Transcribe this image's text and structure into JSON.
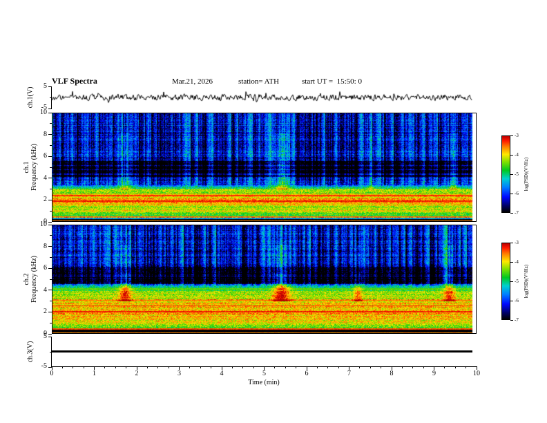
{
  "header": {
    "title": "VLF Spectra",
    "date": "Mar.21, 2026",
    "station": "station= ATH",
    "start_ut": "start UT =  15:50: 0"
  },
  "axes": {
    "time_label": "Time (min)",
    "x_range": [
      0,
      10
    ],
    "xtick_labels": [
      "0",
      "1",
      "2",
      "3",
      "4",
      "5",
      "6",
      "7",
      "8",
      "9",
      "10"
    ],
    "freq_tick_labels": [
      "10",
      "8",
      "6",
      "4",
      "2",
      "0"
    ],
    "volt_tick_top": "5",
    "volt_tick_bottom": "-5"
  },
  "panels": {
    "ch1_wave": {
      "label": "ch.1(V)"
    },
    "ch1_spec": {
      "label_ch": "ch.1",
      "label_axis": "Frequency (kHz)"
    },
    "ch2_spec": {
      "label_ch": "ch.2",
      "label_axis": "Frequency (kHz)"
    },
    "ch3_wave": {
      "label": "ch.3(V)"
    }
  },
  "colorbar": {
    "label": "log(PSD)(V²/Hz)",
    "tick_labels": [
      "-3",
      "-4",
      "-5",
      "-6",
      "-7"
    ],
    "value_top": -3,
    "value_bottom": -7,
    "stops": [
      {
        "pos": 0.0,
        "color": "#000000"
      },
      {
        "pos": 0.08,
        "color": "#000060"
      },
      {
        "pos": 0.2,
        "color": "#0008ff"
      },
      {
        "pos": 0.33,
        "color": "#0080ff"
      },
      {
        "pos": 0.44,
        "color": "#00d0d0"
      },
      {
        "pos": 0.55,
        "color": "#00c820"
      },
      {
        "pos": 0.66,
        "color": "#80e000"
      },
      {
        "pos": 0.76,
        "color": "#ffe800"
      },
      {
        "pos": 0.86,
        "color": "#ff8000"
      },
      {
        "pos": 0.94,
        "color": "#ff1800"
      },
      {
        "pos": 1.0,
        "color": "#b80000"
      }
    ]
  },
  "chart_data": [
    {
      "type": "line",
      "name": "ch1_waveform",
      "ylabel": "ch.1(V)",
      "ylim": [
        -5,
        5
      ],
      "xlim_min": [
        0,
        10
      ],
      "t_end": 9.9,
      "signal": {
        "mean": 0,
        "noise_amp": 1.2,
        "spike_prob": 0.05,
        "spike_amp": 3.2,
        "seed": 9
      }
    },
    {
      "type": "heatmap",
      "name": "ch1_spectrogram",
      "ylabel": "ch.1 Frequency (kHz)",
      "xlim_min": [
        0,
        10
      ],
      "ylim_khz": [
        0,
        10
      ],
      "zlabel": "log(PSD)(V²/Hz)",
      "zlim": [
        -7,
        -3
      ],
      "t_end": 9.9,
      "seed": 42,
      "stripe_density": 0.55,
      "stripe_fmin": 3.1,
      "stripe_max": 2.1,
      "bands": [
        {
          "f0": 0.0,
          "f1": 0.3,
          "level": -7.0
        },
        {
          "f0": 0.3,
          "f1": 0.42,
          "level": -5.6
        },
        {
          "f0": 0.42,
          "f1": 0.56,
          "level": -3.6
        },
        {
          "f0": 0.56,
          "f1": 0.85,
          "level": -4.6
        },
        {
          "f0": 0.85,
          "f1": 1.5,
          "level": -4.2
        },
        {
          "f0": 1.5,
          "f1": 2.65,
          "level": -3.8
        },
        {
          "f0": 2.65,
          "f1": 3.05,
          "level": -4.4
        },
        {
          "f0": 3.05,
          "f1": 4.15,
          "level": -5.0
        },
        {
          "f0": 4.15,
          "f1": 5.6,
          "level": -5.9
        },
        {
          "f0": 5.6,
          "f1": 10.01,
          "level": -5.05
        }
      ],
      "lines": [
        {
          "f": 0.1,
          "w": 0.06,
          "level": -3.6
        },
        {
          "f": 0.5,
          "w": 0.05,
          "level": -3.5
        },
        {
          "f": 1.92,
          "w": 0.05,
          "level": -3.2
        },
        {
          "f": 2.42,
          "w": 0.05,
          "level": -3.3
        },
        {
          "f": 4.4,
          "w": 0.04,
          "level": -5.2
        },
        {
          "f": 4.8,
          "w": 0.04,
          "level": -5.3
        },
        {
          "f": 5.2,
          "w": 0.04,
          "level": -5.25
        }
      ],
      "events": [
        {
          "t": 1.72,
          "width": 0.1,
          "boost": 0.9
        },
        {
          "t": 5.4,
          "width": 0.13,
          "boost": 1.1
        },
        {
          "t": 7.5,
          "width": 0.07,
          "boost": 0.6
        },
        {
          "t": 9.45,
          "width": 0.08,
          "boost": 0.8
        }
      ]
    },
    {
      "type": "heatmap",
      "name": "ch2_spectrogram",
      "ylabel": "ch.2 Frequency (kHz)",
      "xlim_min": [
        0,
        10
      ],
      "ylim_khz": [
        0,
        10
      ],
      "zlabel": "log(PSD)(V²/Hz)",
      "zlim": [
        -7,
        -3
      ],
      "t_end": 9.9,
      "seed": 1337,
      "stripe_density": 0.55,
      "stripe_fmin": 4.2,
      "stripe_max": 2.1,
      "bands": [
        {
          "f0": 0.0,
          "f1": 0.12,
          "level": -6.5
        },
        {
          "f0": 0.12,
          "f1": 0.4,
          "level": -7.0
        },
        {
          "f0": 0.4,
          "f1": 0.55,
          "level": -4.0
        },
        {
          "f0": 0.55,
          "f1": 0.85,
          "level": -4.5
        },
        {
          "f0": 0.85,
          "f1": 1.45,
          "level": -4.0
        },
        {
          "f0": 1.45,
          "f1": 3.2,
          "level": -3.8
        },
        {
          "f0": 3.2,
          "f1": 3.95,
          "level": -4.3
        },
        {
          "f0": 3.95,
          "f1": 4.6,
          "level": -4.9
        },
        {
          "f0": 4.6,
          "f1": 6.2,
          "level": -5.9
        },
        {
          "f0": 6.2,
          "f1": 10.01,
          "level": -5.05
        }
      ],
      "lines": [
        {
          "f": 0.08,
          "w": 0.05,
          "level": -3.6
        },
        {
          "f": 0.47,
          "w": 0.05,
          "level": -3.4
        },
        {
          "f": 2.05,
          "w": 0.05,
          "level": -3.2
        },
        {
          "f": 2.6,
          "w": 0.05,
          "level": -3.3
        },
        {
          "f": 3.1,
          "w": 0.04,
          "level": -3.5
        },
        {
          "f": 4.15,
          "w": 0.04,
          "level": -4.5
        },
        {
          "f": 5.3,
          "w": 0.04,
          "level": -5.3
        }
      ],
      "events": [
        {
          "t": 1.72,
          "width": 0.1,
          "boost": 1.0
        },
        {
          "t": 5.4,
          "width": 0.13,
          "boost": 1.2
        },
        {
          "t": 7.2,
          "width": 0.07,
          "boost": 0.7
        },
        {
          "t": 9.35,
          "width": 0.09,
          "boost": 0.9
        }
      ]
    },
    {
      "type": "line",
      "name": "ch3_waveform",
      "ylabel": "ch.3(V)",
      "ylim": [
        -5,
        5
      ],
      "xlim_min": [
        0,
        10
      ],
      "t_end": 9.9,
      "signal": {
        "flat": true,
        "value": 0
      }
    }
  ]
}
